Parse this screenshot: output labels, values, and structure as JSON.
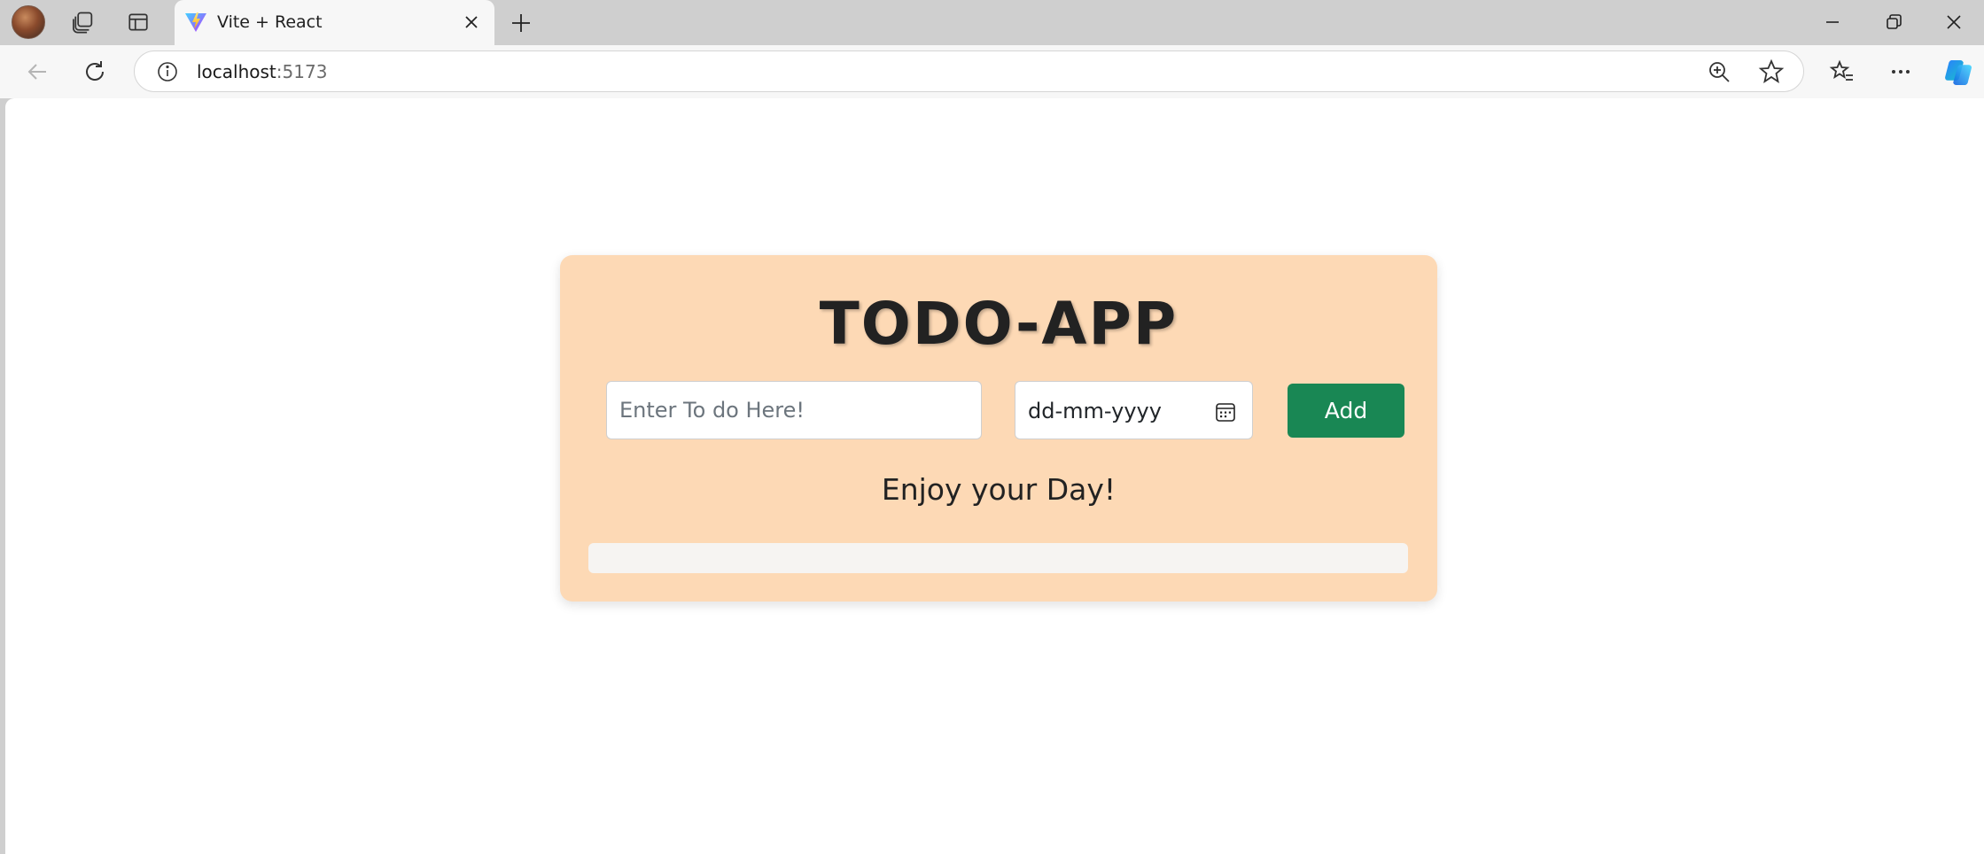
{
  "browser": {
    "tab": {
      "title": "Vite + React"
    },
    "address_bar": {
      "host": "localhost",
      "port": ":5173"
    }
  },
  "app": {
    "title": "TODO-APP",
    "todo_input": {
      "placeholder": "Enter To do Here!",
      "value": ""
    },
    "date_input": {
      "placeholder": "dd-mm-yyyy"
    },
    "add_button_label": "Add",
    "empty_message": "Enjoy your Day!",
    "todo_items": []
  },
  "colors": {
    "card_background": "#fdd9b5",
    "add_button": "#198754",
    "accent_favicon": "#9d5cff"
  },
  "icons": {
    "profile": "avatar",
    "workspaces": "workspaces-icon",
    "vertical_tabs": "tab-actions-icon",
    "favicon": "vite-logo-icon",
    "close": "close-icon",
    "new_tab": "plus-icon",
    "back": "back-arrow-icon",
    "refresh": "refresh-icon",
    "site_info": "info-icon",
    "zoom": "zoom-in-icon",
    "favorite": "star-icon",
    "favorites": "favorites-icon",
    "more": "more-icon",
    "copilot": "copilot-icon",
    "calendar": "calendar-icon"
  }
}
